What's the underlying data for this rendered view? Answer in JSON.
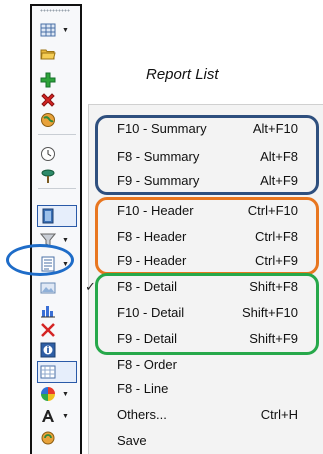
{
  "title": "Report List",
  "colors": {
    "summary_group": "#2e4f7e",
    "header_group": "#e8761f",
    "detail_group": "#26a84a",
    "ellipse": "#1e6cc8"
  },
  "toolbar": {
    "icons": [
      {
        "name": "grid-table-icon",
        "dropdown": true
      },
      {
        "name": "folder-open-icon",
        "dropdown": false
      },
      {
        "name": "add-plus-icon",
        "dropdown": false
      },
      {
        "name": "delete-x-icon",
        "dropdown": false
      },
      {
        "name": "globe-refresh-icon",
        "dropdown": false
      },
      {
        "name": "clock-icon",
        "dropdown": false
      },
      {
        "name": "pushpin-icon",
        "dropdown": false
      },
      {
        "name": "panel-toggle-icon",
        "dropdown": false
      },
      {
        "name": "funnel-filter-icon",
        "dropdown": true
      },
      {
        "name": "report-list-icon",
        "dropdown": true
      },
      {
        "name": "image-icon",
        "dropdown": false
      },
      {
        "name": "bar-chart-icon",
        "dropdown": false
      },
      {
        "name": "close-red-icon",
        "dropdown": false
      },
      {
        "name": "info-icon",
        "dropdown": false
      },
      {
        "name": "grid-view-icon",
        "dropdown": false
      },
      {
        "name": "color-wheel-icon",
        "dropdown": true
      },
      {
        "name": "font-size-icon",
        "dropdown": true
      },
      {
        "name": "sync-icon",
        "dropdown": false
      }
    ]
  },
  "menu": {
    "items": [
      {
        "label": "F10 - Summary",
        "shortcut": "Alt+F10"
      },
      {
        "label": "F8 - Summary",
        "shortcut": "Alt+F8"
      },
      {
        "label": "F9 - Summary",
        "shortcut": "Alt+F9"
      },
      {
        "label": "F10 - Header",
        "shortcut": "Ctrl+F10"
      },
      {
        "label": "F8 - Header",
        "shortcut": "Ctrl+F8"
      },
      {
        "label": "F9 - Header",
        "shortcut": "Ctrl+F9"
      },
      {
        "label": "F8 - Detail",
        "shortcut": "Shift+F8",
        "checked": true
      },
      {
        "label": "F10 - Detail",
        "shortcut": "Shift+F10"
      },
      {
        "label": "F9 - Detail",
        "shortcut": "Shift+F9"
      },
      {
        "label": "F8 - Order",
        "shortcut": ""
      },
      {
        "label": "F8 - Line",
        "shortcut": ""
      },
      {
        "label": "Others...",
        "shortcut": "Ctrl+H"
      },
      {
        "label": "Save",
        "shortcut": ""
      }
    ],
    "check_mark": "✓"
  }
}
